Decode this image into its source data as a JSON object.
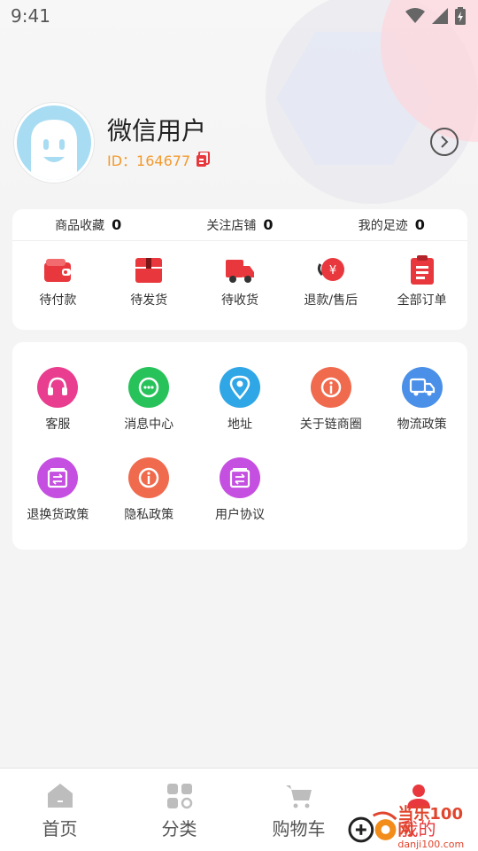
{
  "status_bar": {
    "time": "9:41"
  },
  "profile": {
    "nickname": "微信用户",
    "id_label": "ID：164677"
  },
  "stats": [
    {
      "label": "商品收藏",
      "count": "0"
    },
    {
      "label": "关注店铺",
      "count": "0"
    },
    {
      "label": "我的足迹",
      "count": "0"
    }
  ],
  "orders": [
    {
      "label": "待付款",
      "icon": "wallet-icon"
    },
    {
      "label": "待发货",
      "icon": "package-icon"
    },
    {
      "label": "待收货",
      "icon": "truck-icon"
    },
    {
      "label": "退款/售后",
      "icon": "refund-icon"
    },
    {
      "label": "全部订单",
      "icon": "clipboard-icon"
    }
  ],
  "services": [
    {
      "label": "客服",
      "icon": "headset-icon",
      "color": "#e93d8f"
    },
    {
      "label": "消息中心",
      "icon": "chat-icon",
      "color": "#27c25a"
    },
    {
      "label": "地址",
      "icon": "location-icon",
      "color": "#2fa6e6"
    },
    {
      "label": "关于链商圈",
      "icon": "info-icon",
      "color": "#f06a4e"
    },
    {
      "label": "物流政策",
      "icon": "truck-icon",
      "color": "#4a90e8"
    },
    {
      "label": "退换货政策",
      "icon": "exchange-icon",
      "color": "#c44fe0"
    },
    {
      "label": "隐私政策",
      "icon": "info-icon",
      "color": "#f06a4e"
    },
    {
      "label": "用户协议",
      "icon": "exchange-icon",
      "color": "#c44fe0"
    }
  ],
  "tabs": [
    {
      "label": "首页",
      "icon": "home-icon",
      "active": false
    },
    {
      "label": "分类",
      "icon": "category-icon",
      "active": false
    },
    {
      "label": "购物车",
      "icon": "cart-icon",
      "active": false
    },
    {
      "label": "我的",
      "icon": "user-icon",
      "active": true
    }
  ],
  "watermark": {
    "text": "当乐100网",
    "sub": "danji100.com"
  },
  "colors": {
    "accent": "#e8383d",
    "id_color": "#f39a2e",
    "avatar_bg": "#a7dcf3"
  }
}
